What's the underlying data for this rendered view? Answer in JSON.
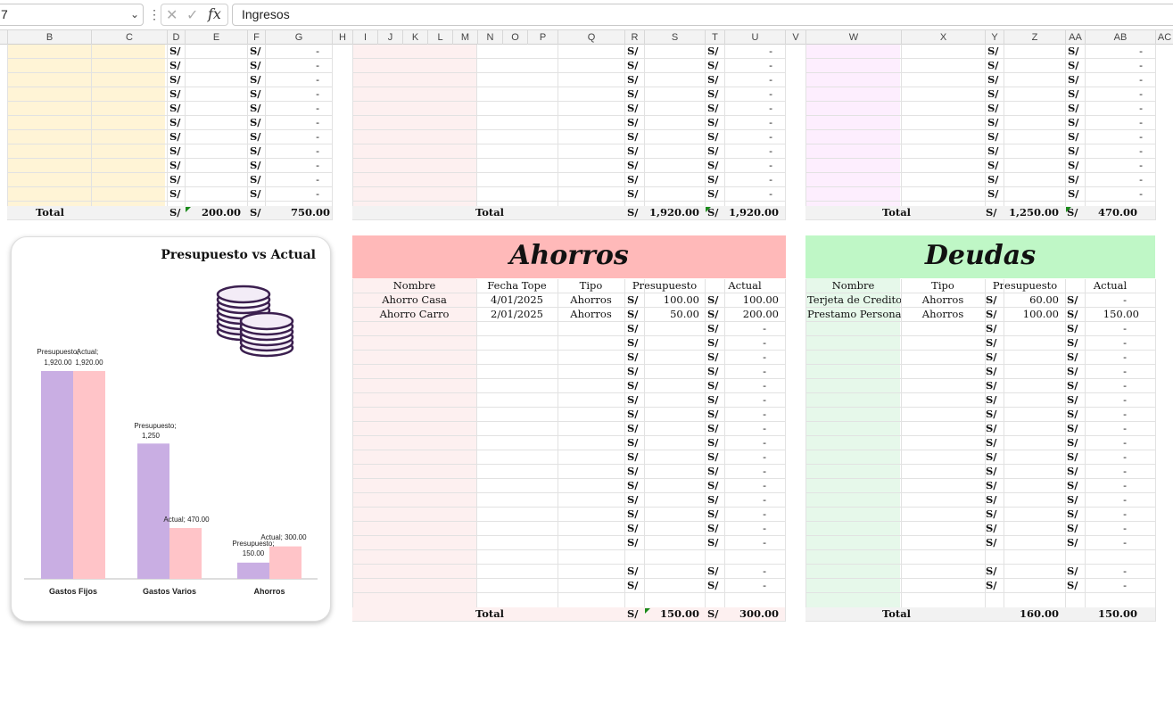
{
  "formula_bar": {
    "name_box": "7",
    "formula": "Ingresos"
  },
  "columns": [
    "B",
    "C",
    "D",
    "E",
    "F",
    "G",
    "H",
    "I",
    "J",
    "K",
    "L",
    "M",
    "N",
    "O",
    "P",
    "Q",
    "R",
    "S",
    "T",
    "U",
    "V",
    "W",
    "X",
    "Y",
    "Z",
    "AA",
    "AB",
    "AC"
  ],
  "currency": "S/",
  "dash": "-",
  "total_label": "Total",
  "top_left": {
    "total_e": "200.00",
    "total_g": "750.00"
  },
  "top_mid": {
    "total_s": "1,920.00",
    "total_u": "1,920.00"
  },
  "top_right": {
    "total_z": "1,250.00",
    "total_ab": "470.00"
  },
  "ahorros": {
    "title": "Ahorros",
    "headers": {
      "nombre": "Nombre",
      "fecha": "Fecha Tope",
      "tipo": "Tipo",
      "presupuesto": "Presupuesto",
      "actual": "Actual"
    },
    "rows": [
      {
        "nombre": "Ahorro Casa",
        "fecha": "4/01/2025",
        "tipo": "Ahorros",
        "presupuesto": "100.00",
        "actual": "100.00"
      },
      {
        "nombre": "Ahorro Carro",
        "fecha": "2/01/2025",
        "tipo": "Ahorros",
        "presupuesto": "50.00",
        "actual": "200.00"
      }
    ],
    "total_presupuesto": "150.00",
    "total_actual": "300.00"
  },
  "deudas": {
    "title": "Deudas",
    "headers": {
      "nombre": "Nombre",
      "tipo": "Tipo",
      "presupuesto": "Presupuesto",
      "actual": "Actual"
    },
    "rows": [
      {
        "nombre": "Terjeta de Credito",
        "tipo": "Ahorros",
        "presupuesto": "60.00",
        "actual": "-"
      },
      {
        "nombre": "Prestamo Personal",
        "tipo": "Ahorros",
        "presupuesto": "100.00",
        "actual": "150.00"
      }
    ],
    "total_presupuesto": "160.00",
    "total_actual": "150.00"
  },
  "chart_data": {
    "type": "bar",
    "title": "Presupuesto vs Actual",
    "categories": [
      "Gastos Fijos",
      "Gastos Varios",
      "Ahorros"
    ],
    "series": [
      {
        "name": "Presupuesto",
        "values": [
          1920,
          1250,
          150
        ],
        "color": "#c9aee3",
        "labels": [
          "1,920.00",
          "1,250",
          "150.00"
        ]
      },
      {
        "name": "Actual",
        "values": [
          1920,
          470,
          300
        ],
        "color": "#ffc4c8",
        "labels": [
          "1,920.00",
          "470.00",
          "300.00"
        ]
      }
    ],
    "ylim": [
      0,
      1920
    ],
    "legend": "none",
    "icon": "coins-icon"
  },
  "colors": {
    "yellow": "#fff4d6",
    "pink_light": "#fdf0f0",
    "lavender": "#fdeefe",
    "mint": "#e6f8ea",
    "ahorros_banner": "#ffb9b9",
    "deudas_banner": "#bff7c6"
  }
}
